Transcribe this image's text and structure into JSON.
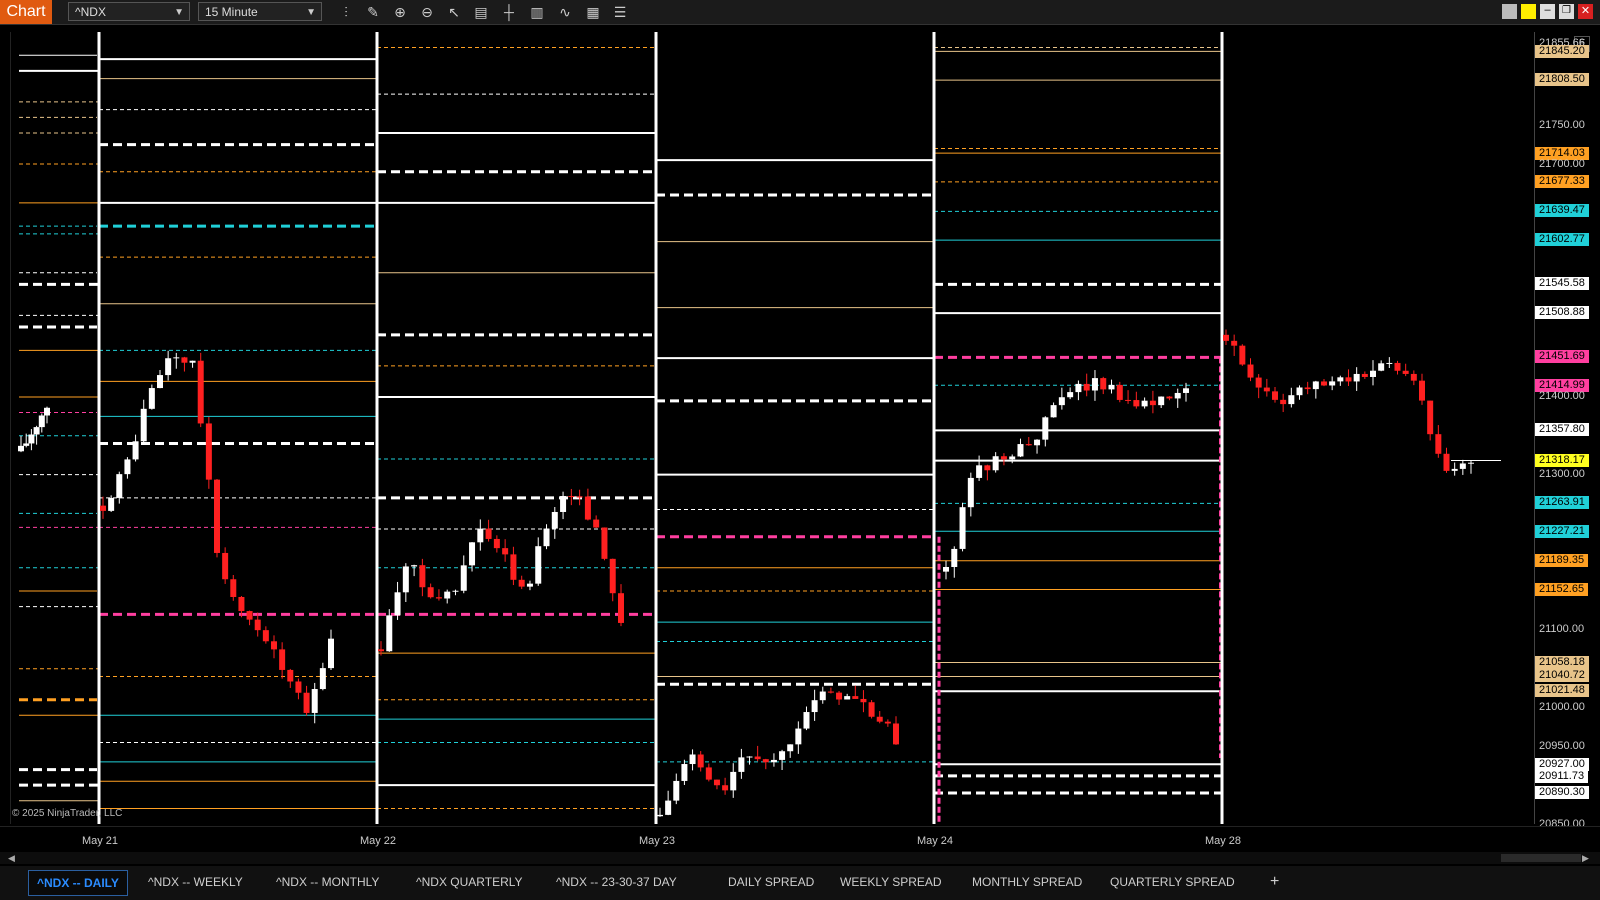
{
  "app": {
    "badge": "Chart"
  },
  "toolbar": {
    "instrument": "^NDX",
    "interval": "15 Minute",
    "tools": [
      "bars-icon",
      "pencil-icon",
      "zoom-in-icon",
      "zoom-out-icon",
      "pointer-icon",
      "data-box-icon",
      "crosshair-icon",
      "chart-style-icon",
      "indicator-icon",
      "calculator-icon",
      "properties-icon"
    ]
  },
  "x_axis": [
    "May 21",
    "May 22",
    "May 23",
    "May 24",
    "May 28"
  ],
  "price_labels": [
    {
      "text": "21855.66",
      "kind": "plain"
    },
    {
      "text": "21845.20",
      "kind": "tan"
    },
    {
      "text": "21808.50",
      "kind": "tan"
    },
    {
      "text": "21750.00",
      "kind": "plain"
    },
    {
      "text": "21714.03",
      "kind": "orange"
    },
    {
      "text": "21700.00",
      "kind": "plain"
    },
    {
      "text": "21677.33",
      "kind": "orange"
    },
    {
      "text": "21639.47",
      "kind": "cyan"
    },
    {
      "text": "21602.77",
      "kind": "cyan"
    },
    {
      "text": "21545.58",
      "kind": "white"
    },
    {
      "text": "21508.88",
      "kind": "white"
    },
    {
      "text": "21451.69",
      "kind": "pink"
    },
    {
      "text": "21414.99",
      "kind": "pink"
    },
    {
      "text": "21400.00",
      "kind": "plain"
    },
    {
      "text": "21357.80",
      "kind": "white"
    },
    {
      "text": "21318.17",
      "kind": "yellow"
    },
    {
      "text": "21300.00",
      "kind": "plain"
    },
    {
      "text": "21263.91",
      "kind": "cyan"
    },
    {
      "text": "21227.21",
      "kind": "cyan"
    },
    {
      "text": "21189.35",
      "kind": "orange"
    },
    {
      "text": "21152.65",
      "kind": "orange"
    },
    {
      "text": "21100.00",
      "kind": "plain"
    },
    {
      "text": "21058.18",
      "kind": "tan"
    },
    {
      "text": "21040.72",
      "kind": "tan"
    },
    {
      "text": "21021.48",
      "kind": "tan"
    },
    {
      "text": "21000.00",
      "kind": "plain"
    },
    {
      "text": "20950.00",
      "kind": "plain"
    },
    {
      "text": "20927.00",
      "kind": "white"
    },
    {
      "text": "20911.73",
      "kind": "white"
    },
    {
      "text": "20890.30",
      "kind": "white"
    },
    {
      "text": "20850.00",
      "kind": "plain"
    }
  ],
  "colors": {
    "white": "#ffffff",
    "tan": "#e8c48a",
    "orange": "#ffa022",
    "cyan": "#20d0d8",
    "pink": "#ff3fa0",
    "yellow": "#ffff20",
    "candle_up": "#ffffff",
    "candle_down": "#ff2020",
    "badge": "#e05a10",
    "active_tab": "#2b8cff"
  },
  "chart_data": {
    "type": "candlestick",
    "instrument": "^NDX",
    "interval": "15 Minute",
    "ylim": [
      20850,
      21870
    ],
    "sessions": [
      {
        "date": "May 21",
        "open": 21320,
        "high": 21455,
        "low": 20990,
        "close": 21090
      },
      {
        "date": "May 22",
        "open": 21075,
        "high": 21280,
        "low": 21075,
        "close": 21112
      },
      {
        "date": "May 23",
        "open": 20860,
        "high": 21025,
        "low": 20850,
        "close": 20960
      },
      {
        "date": "May 24",
        "open": 21175,
        "high": 21420,
        "low": 21175,
        "close": 21405
      },
      {
        "date": "May 28",
        "open": 21480,
        "high": 21470,
        "low": 21300,
        "close": 21318
      }
    ],
    "last_price": 21318.17
  },
  "copyright": "© 2025 NinjaTrader, LLC",
  "tabs": [
    {
      "label": "^NDX -- DAILY",
      "active": true
    },
    {
      "label": "^NDX -- WEEKLY",
      "active": false
    },
    {
      "label": "^NDX -- MONTHLY",
      "active": false
    },
    {
      "label": "^NDX QUARTERLY",
      "active": false
    },
    {
      "label": "^NDX -- 23-30-37 DAY",
      "active": false
    },
    {
      "label": "DAILY SPREAD",
      "active": false
    },
    {
      "label": "WEEKLY SPREAD",
      "active": false
    },
    {
      "label": "MONTHLY SPREAD",
      "active": false
    },
    {
      "label": "QUARTERLY SPREAD",
      "active": false
    }
  ],
  "add_tab": "+"
}
